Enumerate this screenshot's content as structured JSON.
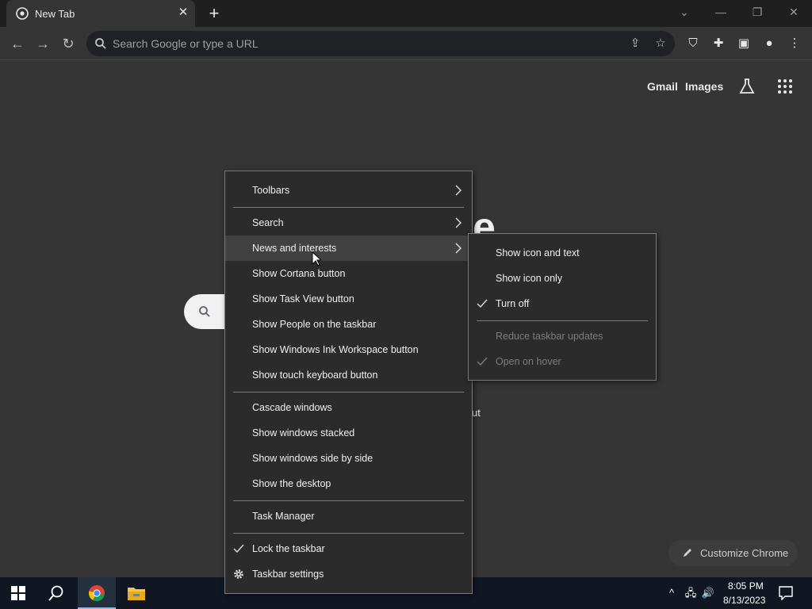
{
  "browser": {
    "tab_title": "New Tab",
    "omnibox_placeholder": "Search Google or type a URL"
  },
  "ntp": {
    "links": [
      "Gmail",
      "Images"
    ],
    "logo_fragment": "e",
    "shortcut_fragment": "ut",
    "customize_label": "Customize Chrome"
  },
  "context_menu": {
    "items": [
      {
        "label": "Toolbars",
        "submenu": true
      },
      {
        "label": "Search",
        "submenu": true
      },
      {
        "label": "News and interests",
        "submenu": true
      },
      {
        "label": "Show Cortana button"
      },
      {
        "label": "Show Task View button"
      },
      {
        "label": "Show People on the taskbar"
      },
      {
        "label": "Show Windows Ink Workspace button"
      },
      {
        "label": "Show touch keyboard button"
      },
      {
        "label": "Cascade windows"
      },
      {
        "label": "Show windows stacked"
      },
      {
        "label": "Show windows side by side"
      },
      {
        "label": "Show the desktop"
      },
      {
        "label": "Task Manager"
      },
      {
        "label": "Lock the taskbar",
        "checked": true
      },
      {
        "label": "Taskbar settings"
      }
    ]
  },
  "submenu": {
    "items": [
      {
        "label": "Show icon and text"
      },
      {
        "label": "Show icon only"
      },
      {
        "label": "Turn off",
        "checked": true
      },
      {
        "label": "Reduce taskbar updates",
        "disabled": true
      },
      {
        "label": "Open on hover",
        "checked": true,
        "disabled": true
      }
    ]
  },
  "taskbar": {
    "time": "8:05 PM",
    "date": "8/13/2023"
  },
  "colors": {
    "browser_bg": "#353535",
    "menu_bg": "#2b2b2b",
    "menu_highlight": "#414141",
    "taskbar_bg": "#101723"
  }
}
